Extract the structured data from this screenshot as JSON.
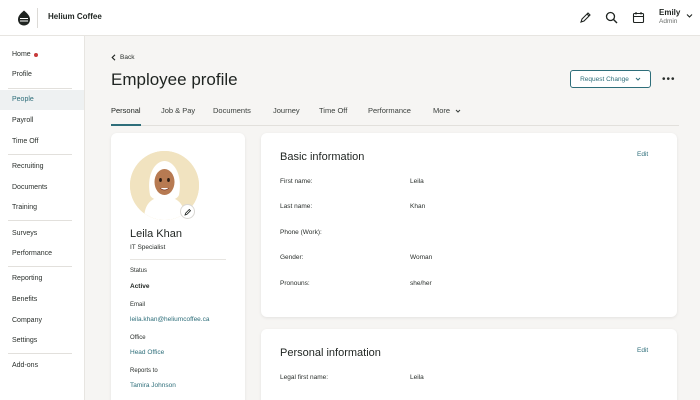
{
  "app": {
    "brand": "Helium Coffee"
  },
  "user": {
    "name": "Emily",
    "role": "Admin"
  },
  "sidebar": {
    "items": [
      {
        "label": "Home"
      },
      {
        "label": "Profile"
      },
      {
        "label": "People"
      },
      {
        "label": "Payroll"
      },
      {
        "label": "Time Off"
      },
      {
        "label": "Recruiting"
      },
      {
        "label": "Documents"
      },
      {
        "label": "Training"
      },
      {
        "label": "Surveys"
      },
      {
        "label": "Performance"
      },
      {
        "label": "Reporting"
      },
      {
        "label": "Benefits"
      },
      {
        "label": "Company"
      },
      {
        "label": "Settings"
      },
      {
        "label": "Add-ons"
      }
    ],
    "active": "People",
    "notification_color": "#c73a3a"
  },
  "header": {
    "back_label": "Back",
    "title": "Employee profile",
    "request_change_label": "Request Change",
    "more_label": "•••"
  },
  "tabs": [
    {
      "label": "Personal"
    },
    {
      "label": "Job & Pay"
    },
    {
      "label": "Documents"
    },
    {
      "label": "Journey"
    },
    {
      "label": "Time Off"
    },
    {
      "label": "Performance"
    },
    {
      "label": "More"
    }
  ],
  "profile": {
    "name": "Leila Khan",
    "title": "IT Specialist",
    "status_label": "Status",
    "status": "Active",
    "email_label": "Email",
    "email": "leila.khan@heliumcoffee.ca",
    "office_label": "Office",
    "office": "Head Office",
    "reports_to_label": "Reports to",
    "reports_to": "Tamira Johnson"
  },
  "basic_info": {
    "title": "Basic information",
    "edit_label": "Edit",
    "fields": [
      {
        "label": "First name:",
        "value": "Leila"
      },
      {
        "label": "Last name:",
        "value": "Khan"
      },
      {
        "label": "Phone (Work):",
        "value": ""
      },
      {
        "label": "Gender:",
        "value": "Woman"
      },
      {
        "label": "Pronouns:",
        "value": "she/her"
      }
    ]
  },
  "personal_info": {
    "title": "Personal information",
    "edit_label": "Edit",
    "fields": [
      {
        "label": "Legal first name:",
        "value": "Leila"
      }
    ]
  },
  "colors": {
    "accent": "#2e6e7a",
    "background": "#f6f5f3"
  }
}
